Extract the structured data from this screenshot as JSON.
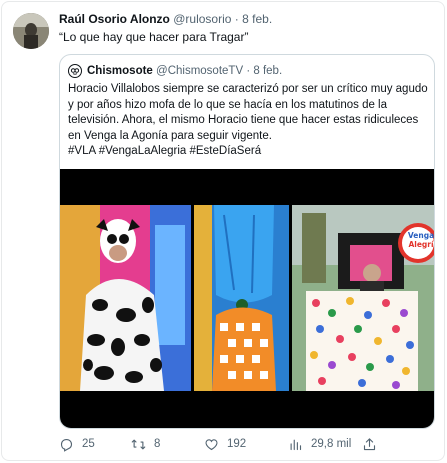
{
  "tweet": {
    "author_name": "Raúl Osorio Alonzo",
    "author_handle": "@rulosorio",
    "separator": "·",
    "date": "8 feb.",
    "text": "“Lo que hay que hacer para Tragar”"
  },
  "quote": {
    "author_name": "Chismosote",
    "author_handle": "@ChismosoteTV",
    "separator": "·",
    "date": "8 feb.",
    "text": "Horacio Villalobos siempre se caracterizó por ser un crítico muy agudo y por años hizo mofa de lo que se hacía en los matutinos de la televisión. Ahora, el mismo Horacio tiene que hacer estas ridiculeces en Venga la Agonía para seguir vigente.",
    "hashtags": "#VLA #VengaLaAlegria #EsteDíaSerá",
    "media": {
      "sign_line1": "Venga",
      "sign_line2": "Alegrí"
    }
  },
  "actions": {
    "replies": "25",
    "retweets": "8",
    "likes": "192",
    "views": "29,8 mil"
  },
  "colors": {
    "text": "#0f1419",
    "muted": "#536471",
    "border": "#cfd9de"
  }
}
